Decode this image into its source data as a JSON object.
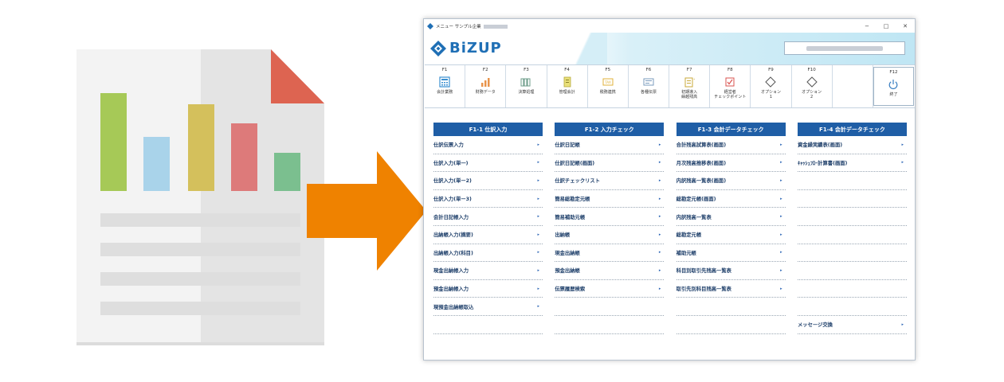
{
  "window": {
    "title": "メニュー サンプル企業",
    "controls": [
      "−",
      "□",
      "✕"
    ],
    "logo_text": "BiZUP"
  },
  "colors": {
    "brand_blue": "#1f6fb5",
    "column_header": "#1f5ea6",
    "arrow_orange": "#ef8200",
    "header_band": "#bfe6f4"
  },
  "fkeys": [
    {
      "code": "F1",
      "label": "会計業務",
      "icon": "calculator-icon"
    },
    {
      "code": "F2",
      "label": "財務データ",
      "icon": "bar-chart-icon"
    },
    {
      "code": "F3",
      "label": "決算処理",
      "icon": "books-icon"
    },
    {
      "code": "F4",
      "label": "管理会計",
      "icon": "ledger-icon"
    },
    {
      "code": "F5",
      "label": "税務連携",
      "icon": "tax-icon"
    },
    {
      "code": "F6",
      "label": "各種伝票",
      "icon": "slip-icon"
    },
    {
      "code": "F7",
      "label": "初期導入\n繰越残高",
      "icon": "memo-icon"
    },
    {
      "code": "F8",
      "label": "経営者\nチェックポイント",
      "icon": "check-mail-icon"
    },
    {
      "code": "F9",
      "label": "オプション\n1",
      "icon": "diamond-icon"
    },
    {
      "code": "F10",
      "label": "オプション\n2",
      "icon": "diamond-icon"
    },
    {
      "code": "",
      "label": "",
      "icon": ""
    },
    {
      "code": "F12",
      "label": "終了",
      "icon": "power-icon"
    }
  ],
  "columns": [
    {
      "header": "F1-1 仕訳入力",
      "items": [
        "仕訳伝票入力",
        "仕訳入力(単一)",
        "仕訳入力(単ー2)",
        "仕訳入力(単ー3)",
        "会計日記帳入力",
        "出納帳入力(摘要)",
        "出納帳入力(科目)",
        "現金出納帳入力",
        "預金出納帳入力",
        "現預金出納帳取込",
        ""
      ]
    },
    {
      "header": "F1-2 入力チェック",
      "items": [
        "仕訳日記帳",
        "仕訳日記帳(画面)",
        "仕訳チェックリスト",
        "簡易総勘定元帳",
        "簡易補助元帳",
        "出納帳",
        "現金出納帳",
        "預金出納帳",
        "伝票履歴検索",
        "",
        ""
      ]
    },
    {
      "header": "F1-3 会計データチェック",
      "items": [
        "合計残高試算表(画面)",
        "月次残高推移表(画面)",
        "内訳残高一覧表(画面)",
        "総勘定元帳(画面)",
        "内訳残高一覧表",
        "総勘定元帳",
        "補助元帳",
        "科目別取引先残高一覧表",
        "取引先別科目残高一覧表",
        "",
        ""
      ]
    },
    {
      "header": "F1-4 会計データチェック",
      "items": [
        "資金繰実績表(画面)",
        "ｷｬｯｼｭﾌﾛｰ計算書(画面)",
        "",
        "",
        "",
        "",
        "",
        "",
        "",
        "",
        "メッセージ交換"
      ]
    }
  ],
  "chevron": "▸"
}
